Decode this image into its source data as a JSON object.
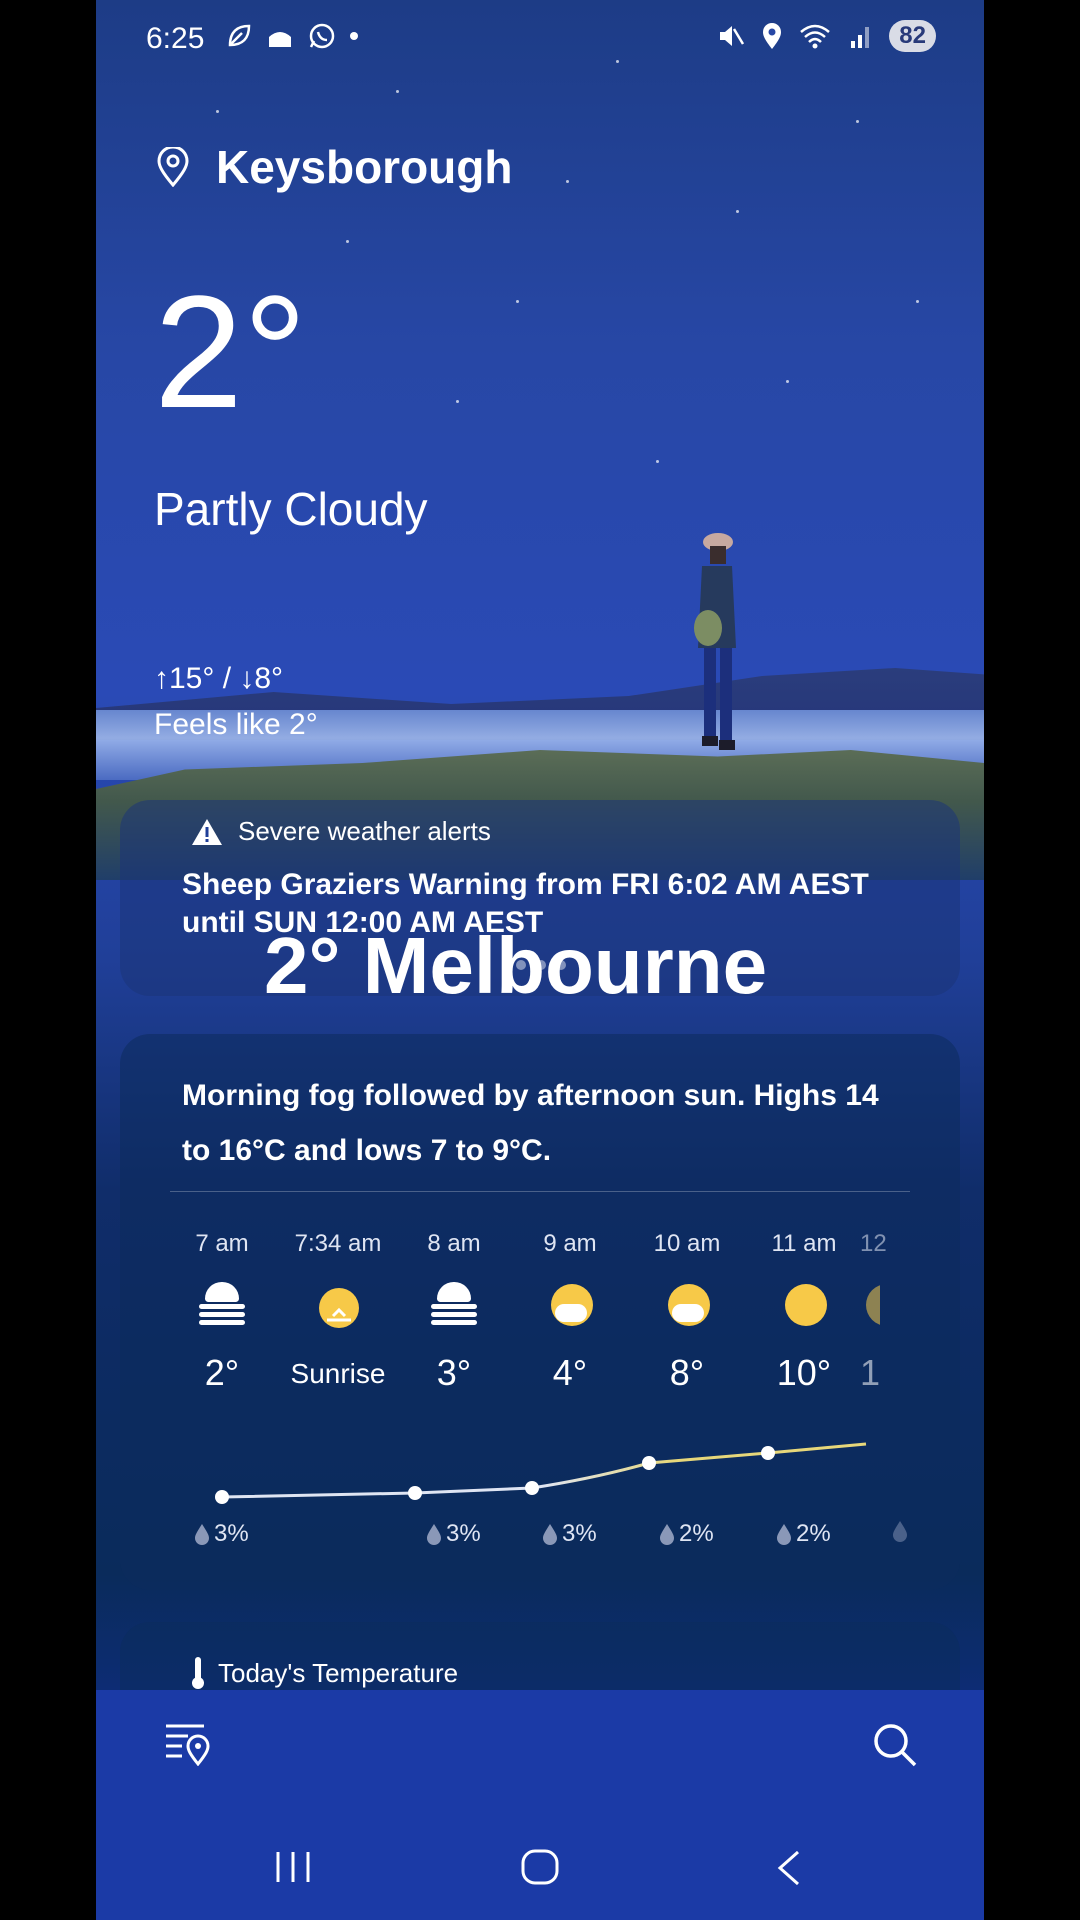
{
  "status_bar": {
    "time": "6:25",
    "battery": "82"
  },
  "location": {
    "city": "Keysborough"
  },
  "current": {
    "temp": "2°",
    "condition": "Partly Cloudy",
    "hi_lo": "↑15° / ↓8°",
    "feels_like": "Feels like 2°"
  },
  "alert": {
    "heading": "Severe weather alerts",
    "text": "Sheep Graziers Warning from FRI 6:02 AM AEST until SUN 12:00 AM AEST"
  },
  "overlay_title": "2° Melbourne",
  "forecast": {
    "summary": "Morning fog followed by afternoon sun. Highs 14 to 16°C and lows 7 to 9°C.",
    "hours": [
      {
        "time": "7 am",
        "icon": "fog-icon",
        "temp": "2°",
        "precip": "3%"
      },
      {
        "time": "7:34 am",
        "icon": "sunrise-icon",
        "temp": "Sunrise",
        "precip": ""
      },
      {
        "time": "8 am",
        "icon": "fog-icon",
        "temp": "3°",
        "precip": "3%"
      },
      {
        "time": "9 am",
        "icon": "sun-cloud-icon",
        "temp": "4°",
        "precip": "3%"
      },
      {
        "time": "10 am",
        "icon": "sun-cloud-icon",
        "temp": "8°",
        "precip": "2%"
      },
      {
        "time": "11 am",
        "icon": "sun-icon",
        "temp": "10°",
        "precip": "2%"
      },
      {
        "time": "12",
        "icon": "sun-cloud-icon",
        "temp": "1",
        "precip": ""
      }
    ]
  },
  "today_section": {
    "label": "Today's Temperature"
  },
  "colors": {
    "sun": "#f7c948",
    "graph_warm": "#e7d77a",
    "graph_cool": "#dfe5f3",
    "bottom_bar": "#1b3aa6"
  }
}
